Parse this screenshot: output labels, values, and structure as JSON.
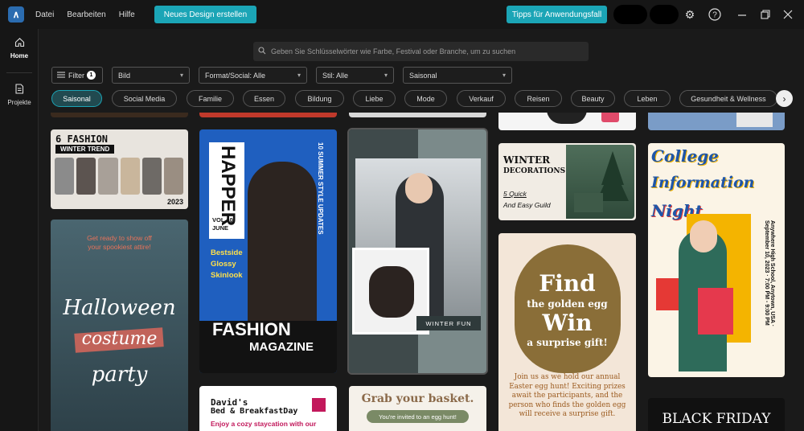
{
  "menu": {
    "file": "Datei",
    "edit": "Bearbeiten",
    "help": "Hilfe"
  },
  "buttons": {
    "new_design": "Neues Design erstellen",
    "tips": "Tipps für Anwendungsfall"
  },
  "sidebar": {
    "home": "Home",
    "projects": "Projekte"
  },
  "search": {
    "placeholder": "Geben Sie Schlüsselwörter wie Farbe, Festival oder Branche, um zu suchen"
  },
  "filters": {
    "filter_label": "Filter",
    "filter_count": "1",
    "type": "Bild",
    "format": "Format/Social: Alle",
    "style": "Stil: Alle",
    "season": "Saisonal"
  },
  "chips": [
    "Saisonal",
    "Social Media",
    "Familie",
    "Essen",
    "Bildung",
    "Liebe",
    "Mode",
    "Verkauf",
    "Reisen",
    "Beauty",
    "Leben",
    "Gesundheit & Wellness"
  ],
  "cards": {
    "fashion_trend": {
      "title": "6 FASHION",
      "sub": "WINTER TREND",
      "year": "2023"
    },
    "halloween": {
      "tag1": "Get ready to show off",
      "tag2": "your spookiest attire!",
      "line1": "Halloween",
      "line2": "costume",
      "line3": "party"
    },
    "magazine": {
      "title": "HAPPER",
      "vol": "VOL 10",
      "month": "JUNE",
      "side": "10 SUMMER STYLE UPDATES",
      "b1": "Bestside",
      "b2": "Glossy",
      "b3": "Skinlook",
      "foot1": "FASHION",
      "foot2": "MAGAZINE"
    },
    "winter_fun": {
      "label": "WINTER FUN"
    },
    "bnb": {
      "line1": "David's",
      "line2": "Bed & BreakfastDay",
      "line3": "Enjoy a cozy staycation with our"
    },
    "basket": {
      "title": "Grab your basket.",
      "pill": "You're invited to an egg hunt!"
    },
    "winter_deco": {
      "l1": "WINTER",
      "l2": "DECORATIONS",
      "l3": "5 Quick",
      "l4": "And Easy Guild"
    },
    "easter": {
      "find": "Find",
      "golden": "the golden egg",
      "win": "Win",
      "gift": "a surprise gift!",
      "body": "Join us as we hold our annual Easter egg hunt! Exciting prizes await the participants, and the person who finds the golden egg will receive a surprise gift."
    },
    "college": {
      "l1": "College",
      "l2": "Information",
      "l3": "Night",
      "side": "Anywhere High School, Anytown, USA · September 10, 2023 · 7:00 PM - 9:00 PM"
    },
    "black_friday": {
      "title": "BLACK FRIDAY"
    }
  },
  "colors": {
    "accent": "#1ba5b6",
    "bg": "#1a1a1a"
  }
}
